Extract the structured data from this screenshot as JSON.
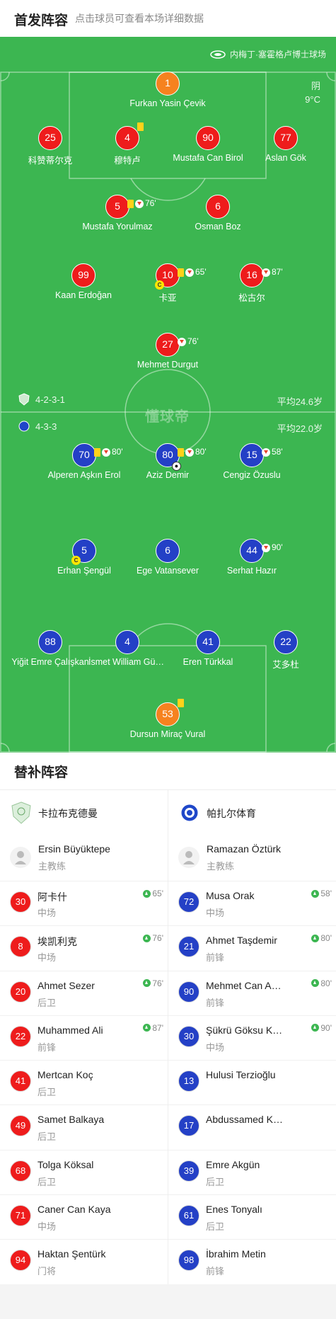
{
  "header": {
    "title": "首发阵容",
    "subtitle": "点击球员可查看本场详细数据"
  },
  "venue": {
    "name": "内梅丁·塞霍格卢博士球场",
    "icon": "stadium-icon"
  },
  "weather": {
    "condition": "阴",
    "temperature": "9°C"
  },
  "watermark": "懂球帝",
  "home_formation": {
    "formation": "4-2-3-1",
    "avg_age": "平均24.6岁",
    "color": "#ee1c1c"
  },
  "away_formation": {
    "formation": "4-3-3",
    "avg_age": "平均22.0岁",
    "color": "#2440c6"
  },
  "home_players": {
    "gk": {
      "number": "1",
      "name": "Furkan Yasin Çevik"
    },
    "d1": {
      "number": "25",
      "name": "科赞蒂尔克"
    },
    "d2": {
      "number": "4",
      "name": "穆特卢"
    },
    "d3": {
      "number": "90",
      "name": "Mustafa Can Birol"
    },
    "d4": {
      "number": "77",
      "name": "Aslan Gök"
    },
    "m1": {
      "number": "5",
      "name": "Mustafa Yorulmaz",
      "sub_time": "76'"
    },
    "m2": {
      "number": "6",
      "name": "Osman Boz"
    },
    "a1": {
      "number": "99",
      "name": "Kaan Erdoğan"
    },
    "a2": {
      "number": "10",
      "name": "卡亚",
      "sub_time": "65'",
      "captain": "C"
    },
    "a3": {
      "number": "16",
      "name": "松古尔",
      "sub_time": "87'"
    },
    "st": {
      "number": "27",
      "name": "Mehmet Durgut",
      "sub_time": "76'"
    }
  },
  "away_players": {
    "f1": {
      "number": "70",
      "name": "Alperen Aşkın Erol",
      "sub_time": "80'"
    },
    "f2": {
      "number": "80",
      "name": "Aziz Demir",
      "sub_time": "80'"
    },
    "f3": {
      "number": "15",
      "name": "Cengiz Özuslu",
      "sub_time": "58'"
    },
    "m1": {
      "number": "5",
      "name": "Erhan Şengül",
      "captain": "C"
    },
    "m2": {
      "number": "6",
      "name": "Ege Vatansever"
    },
    "m3": {
      "number": "44",
      "name": "Serhat Hazır",
      "sub_time": "90'"
    },
    "d1": {
      "number": "88",
      "name": "Yiğit Emre Çalışkan"
    },
    "d2": {
      "number": "4",
      "name": "İsmet William Güneş"
    },
    "d3": {
      "number": "41",
      "name": "Eren Türkkal"
    },
    "d4": {
      "number": "22",
      "name": "艾多杜"
    },
    "gk": {
      "number": "53",
      "name": "Dursun Miraç Vural"
    }
  },
  "substitutes": {
    "title": "替补阵容",
    "home_team": {
      "name": "卡拉布克德曼",
      "icon": "shield-crest-icon"
    },
    "away_team": {
      "name": "帕扎尔体育",
      "icon": "round-crest-icon"
    },
    "home_coach": {
      "name": "Ersin Büyüktepe",
      "role": "主教练"
    },
    "away_coach": {
      "name": "Ramazan Öztürk",
      "role": "主教练"
    },
    "home": [
      {
        "number": "30",
        "name": "阿卡什",
        "pos": "中场",
        "in": "65'"
      },
      {
        "number": "8",
        "name": "埃凯利克",
        "pos": "中场",
        "in": "76'"
      },
      {
        "number": "20",
        "name": "Ahmet Sezer",
        "pos": "后卫",
        "in": "76'"
      },
      {
        "number": "22",
        "name": "Muhammed Ali",
        "pos": "前锋",
        "in": "87'"
      },
      {
        "number": "41",
        "name": "Mertcan Koç",
        "pos": "后卫"
      },
      {
        "number": "49",
        "name": "Samet Balkaya",
        "pos": "后卫"
      },
      {
        "number": "68",
        "name": "Tolga Köksal",
        "pos": "后卫"
      },
      {
        "number": "71",
        "name": "Caner Can Kaya",
        "pos": "中场"
      },
      {
        "number": "94",
        "name": "Haktan Şentürk",
        "pos": "门将"
      }
    ],
    "away": [
      {
        "number": "72",
        "name": "Musa Orak",
        "pos": "中场",
        "in": "58'"
      },
      {
        "number": "21",
        "name": "Ahmet Taşdemir",
        "pos": "前锋",
        "in": "80'"
      },
      {
        "number": "90",
        "name": "Mehmet Can Arslan",
        "pos": "前锋",
        "in": "80'"
      },
      {
        "number": "30",
        "name": "Şükrü Göksu Kaya",
        "pos": "中场",
        "in": "90'"
      },
      {
        "number": "13",
        "name": "Hulusi Terzioğlu",
        "pos": ""
      },
      {
        "number": "17",
        "name": "Abdussamed Karnuçu",
        "pos": ""
      },
      {
        "number": "39",
        "name": "Emre Akgün",
        "pos": "后卫"
      },
      {
        "number": "61",
        "name": "Enes Tonyalı",
        "pos": "后卫"
      },
      {
        "number": "98",
        "name": "İbrahim Metin",
        "pos": "前锋"
      }
    ]
  }
}
